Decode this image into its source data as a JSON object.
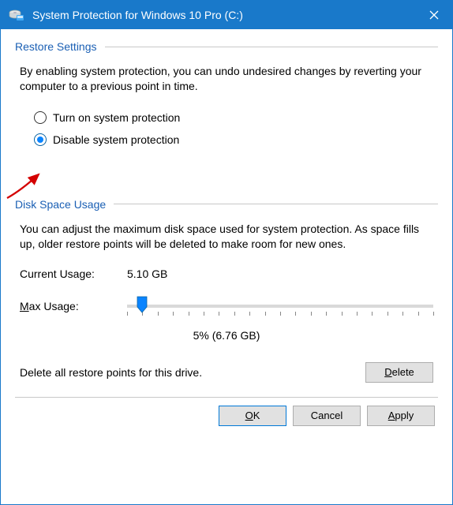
{
  "window": {
    "title": "System Protection for Windows 10 Pro (C:)"
  },
  "restore": {
    "header": "Restore Settings",
    "description": "By enabling system protection, you can undo undesired changes by reverting your computer to a previous point in time.",
    "option_on": "Turn on system protection",
    "option_off": "Disable system protection",
    "selected": "off"
  },
  "disk": {
    "header": "Disk Space Usage",
    "description": "You can adjust the maximum disk space used for system protection. As space fills up, older restore points will be deleted to make room for new ones.",
    "current_usage_label": "Current Usage:",
    "current_usage_value": "5.10 GB",
    "max_usage_label_underlined_char": "M",
    "max_usage_label_rest": "ax Usage:",
    "slider_percent": 5,
    "slider_caption": "5% (6.76 GB)",
    "delete_text": "Delete all restore points for this drive.",
    "delete_button_underlined_char": "D",
    "delete_button_rest": "elete"
  },
  "actions": {
    "ok_underlined": "O",
    "ok_rest": "K",
    "cancel": "Cancel",
    "apply_underlined": "A",
    "apply_rest": "pply"
  }
}
